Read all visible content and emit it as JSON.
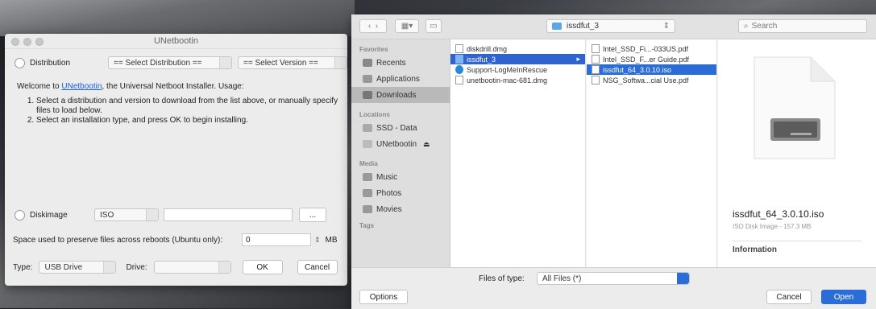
{
  "unetbootin": {
    "title": "UNetbootin",
    "distribution_label": "Distribution",
    "select_distribution": "== Select Distribution ==",
    "select_version": "== Select Version ==",
    "welcome_prefix": "Welcome to ",
    "welcome_link": "UNetbootin",
    "welcome_suffix": ", the Universal Netboot Installer. Usage:",
    "steps": [
      "Select a distribution and version to download from the list above, or manually specify files to load below.",
      "Select an installation type, and press OK to begin installing."
    ],
    "diskimage_label": "Diskimage",
    "diskimage_type": "ISO",
    "diskimage_path": "",
    "browse_label": "...",
    "space_label": "Space used to preserve files across reboots (Ubuntu only):",
    "space_value": "0",
    "space_unit": "MB",
    "type_label": "Type:",
    "type_value": "USB Drive",
    "drive_label": "Drive:",
    "drive_value": "",
    "ok_label": "OK",
    "cancel_label": "Cancel"
  },
  "dialog": {
    "path_folder": "issdfut_3",
    "search_placeholder": "Search",
    "sidebar": {
      "favorites_header": "Favorites",
      "favorites": [
        "Recents",
        "Applications",
        "Downloads"
      ],
      "locations_header": "Locations",
      "locations": [
        "SSD - Data",
        "UNetbootin"
      ],
      "media_header": "Media",
      "media": [
        "Music",
        "Photos",
        "Movies"
      ],
      "tags_header": "Tags"
    },
    "column1": [
      "diskdrill.dmg",
      "issdfut_3",
      "Support-LogMeInRescue",
      "unetbootin-mac-681.dmg"
    ],
    "column2": [
      "Intel_SSD_Fi...-033US.pdf",
      "Intel_SSD_F...er Guide.pdf",
      "issdfut_64_3.0.10.iso",
      "NSG_Softwa...cial Use.pdf"
    ],
    "preview": {
      "filename": "issdfut_64_3.0.10.iso",
      "kind": "ISO Disk Image - 157.3 MB",
      "info_header": "Information"
    },
    "files_of_type_label": "Files of type:",
    "files_of_type_value": "All Files (*)",
    "options_label": "Options",
    "cancel_label": "Cancel",
    "open_label": "Open"
  },
  "colors": {
    "accent": "#2a6dd8",
    "link": "#1a5ed8"
  }
}
